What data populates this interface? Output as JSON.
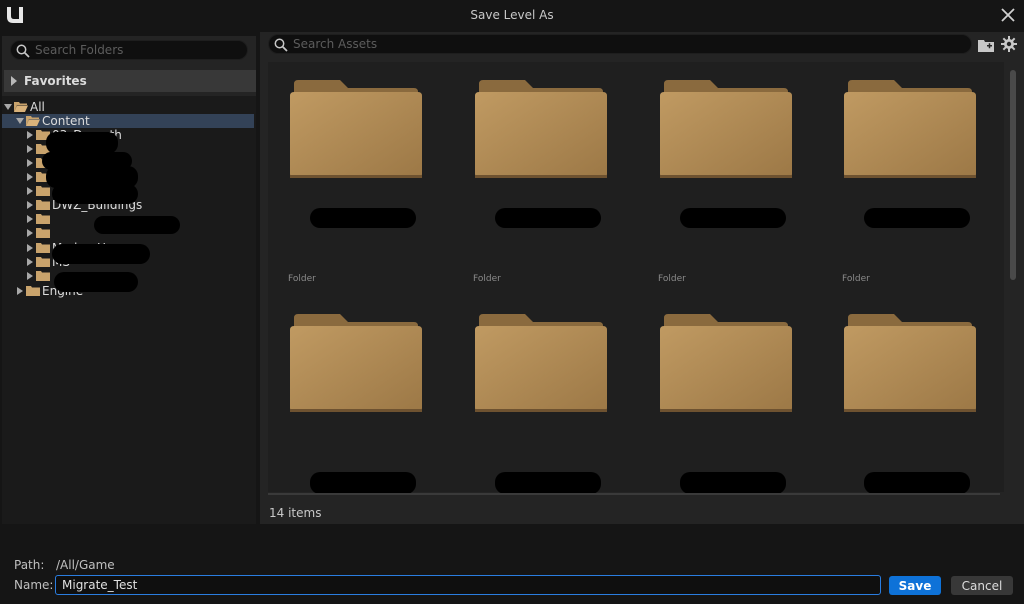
{
  "window": {
    "title": "Save Level As",
    "logo_icon": "unreal-engine-logo",
    "close_icon": "close-icon"
  },
  "left_panel": {
    "search_placeholder": "Search Folders",
    "favorites_label": "Favorites",
    "tree": [
      {
        "label": "All",
        "level": 0,
        "expanded": true,
        "selected": false
      },
      {
        "label": "Content",
        "level": 1,
        "expanded": true,
        "selected": true
      },
      {
        "label": "03_Dagroth",
        "level": 2,
        "expanded": false,
        "selected": false
      },
      {
        "label": "",
        "level": 2,
        "expanded": false,
        "selected": false
      },
      {
        "label": "",
        "level": 2,
        "expanded": false,
        "selected": false
      },
      {
        "label": "",
        "level": 2,
        "expanded": false,
        "selected": false
      },
      {
        "label": "",
        "level": 2,
        "expanded": false,
        "selected": false
      },
      {
        "label": "DWZ_Buildings",
        "level": 2,
        "expanded": false,
        "selected": false
      },
      {
        "label": "",
        "level": 2,
        "expanded": false,
        "selected": false
      },
      {
        "label": "",
        "level": 2,
        "expanded": false,
        "selected": false
      },
      {
        "label": "ModernHouse",
        "level": 2,
        "expanded": false,
        "selected": false
      },
      {
        "label": "MS",
        "level": 2,
        "expanded": false,
        "selected": false
      },
      {
        "label": "",
        "level": 2,
        "expanded": false,
        "selected": false
      },
      {
        "label": "Engine",
        "level": 1,
        "expanded": false,
        "selected": false
      }
    ]
  },
  "right_panel": {
    "search_placeholder": "Search Assets",
    "items_count": "14 items",
    "assets": [
      {
        "name": "",
        "type": "Folder"
      },
      {
        "name": "",
        "type": "Folder"
      },
      {
        "name": "",
        "type": "Folder"
      },
      {
        "name": "",
        "type": "Folder"
      },
      {
        "name": "",
        "type": ""
      },
      {
        "name": "",
        "type": ""
      },
      {
        "name": "",
        "type": ""
      },
      {
        "name": "",
        "type": ""
      }
    ]
  },
  "footer": {
    "path_label": "Path:",
    "path_value": "/All/Game",
    "name_label": "Name:",
    "name_value": "Migrate_Test",
    "save_label": "Save",
    "cancel_label": "Cancel"
  },
  "colors": {
    "accent": "#0e72d8",
    "selection": "#334257",
    "folder": "#b08a54"
  }
}
